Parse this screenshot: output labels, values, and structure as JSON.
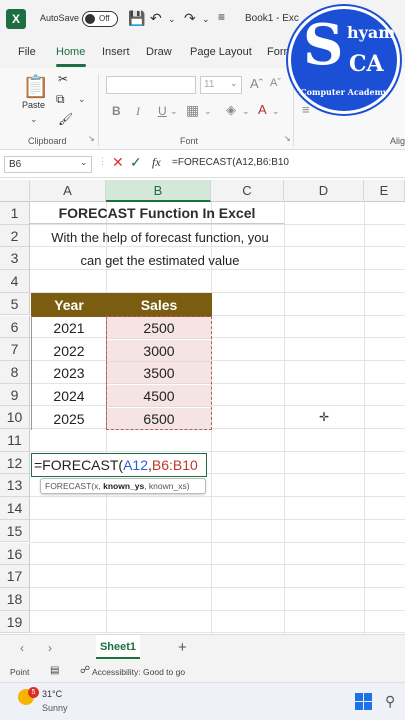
{
  "titlebar": {
    "autosave_label": "AutoSave",
    "toggle_state": "Off",
    "book_title": "Book1 - Exc"
  },
  "menu": {
    "items": [
      "File",
      "Home",
      "Insert",
      "Draw",
      "Page Layout",
      "Form"
    ],
    "active": "Home"
  },
  "ribbon": {
    "paste_label": "Paste",
    "clipboard_label": "Clipboard",
    "font_label": "Font",
    "align_label": "Alig",
    "font_size": "11",
    "bold": "B",
    "italic": "I",
    "underline": "U"
  },
  "formula_bar": {
    "name_box": "B6",
    "fx": "fx",
    "formula": "=FORECAST(A12,B6:B10"
  },
  "columns": [
    "A",
    "B",
    "C",
    "D",
    "E"
  ],
  "rows": [
    "1",
    "2",
    "3",
    "4",
    "5",
    "6",
    "7",
    "8",
    "9",
    "10",
    "11",
    "12",
    "13",
    "14",
    "15",
    "16",
    "17",
    "18",
    "19"
  ],
  "sheet": {
    "title": "FORECAST Function In Excel",
    "desc_line1": "With the help of forecast function, you",
    "desc_line2": "can get the estimated value",
    "header_year": "Year",
    "header_sales": "Sales",
    "data": [
      {
        "year": "2021",
        "sales": "2500"
      },
      {
        "year": "2022",
        "sales": "3000"
      },
      {
        "year": "2023",
        "sales": "3500"
      },
      {
        "year": "2024",
        "sales": "4500"
      },
      {
        "year": "2025",
        "sales": "6500"
      }
    ],
    "edit_prefix": "=FORECAST(",
    "edit_ref1": "A12",
    "edit_comma": ",",
    "edit_ref2": "B6:B10",
    "tooltip_fn": "FORECAST(x, ",
    "tooltip_bold": "known_ys",
    "tooltip_rest": ", known_xs)"
  },
  "tabs": {
    "sheet1": "Sheet1",
    "add": "+"
  },
  "status": {
    "mode": "Point",
    "accessibility": "Accessibility: Good to go"
  },
  "taskbar": {
    "badge": "5",
    "temp": "31°C",
    "condition": "Sunny"
  },
  "logo": {
    "initial": "S",
    "text_top": "hyam",
    "text_ca": "CA",
    "subtitle": "Computer Academy"
  },
  "colors": {
    "excel_green": "#1d6f42",
    "header_brown": "#7b5d12",
    "sales_fill": "#f6e4e4",
    "logo_blue": "#1b4fd6"
  }
}
